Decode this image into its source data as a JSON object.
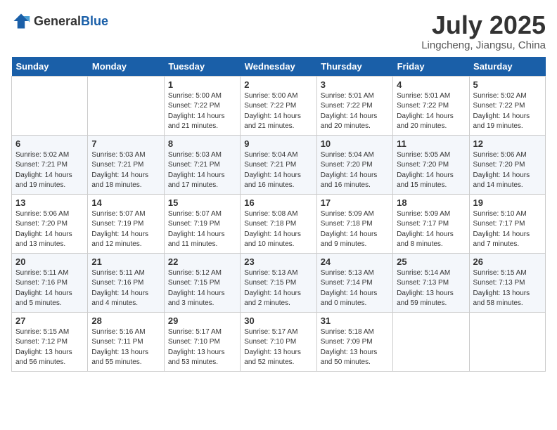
{
  "header": {
    "logo_general": "General",
    "logo_blue": "Blue",
    "month_title": "July 2025",
    "location": "Lingcheng, Jiangsu, China"
  },
  "days_of_week": [
    "Sunday",
    "Monday",
    "Tuesday",
    "Wednesday",
    "Thursday",
    "Friday",
    "Saturday"
  ],
  "weeks": [
    [
      {
        "day": "",
        "info": ""
      },
      {
        "day": "",
        "info": ""
      },
      {
        "day": "1",
        "info": "Sunrise: 5:00 AM\nSunset: 7:22 PM\nDaylight: 14 hours and 21 minutes."
      },
      {
        "day": "2",
        "info": "Sunrise: 5:00 AM\nSunset: 7:22 PM\nDaylight: 14 hours and 21 minutes."
      },
      {
        "day": "3",
        "info": "Sunrise: 5:01 AM\nSunset: 7:22 PM\nDaylight: 14 hours and 20 minutes."
      },
      {
        "day": "4",
        "info": "Sunrise: 5:01 AM\nSunset: 7:22 PM\nDaylight: 14 hours and 20 minutes."
      },
      {
        "day": "5",
        "info": "Sunrise: 5:02 AM\nSunset: 7:22 PM\nDaylight: 14 hours and 19 minutes."
      }
    ],
    [
      {
        "day": "6",
        "info": "Sunrise: 5:02 AM\nSunset: 7:21 PM\nDaylight: 14 hours and 19 minutes."
      },
      {
        "day": "7",
        "info": "Sunrise: 5:03 AM\nSunset: 7:21 PM\nDaylight: 14 hours and 18 minutes."
      },
      {
        "day": "8",
        "info": "Sunrise: 5:03 AM\nSunset: 7:21 PM\nDaylight: 14 hours and 17 minutes."
      },
      {
        "day": "9",
        "info": "Sunrise: 5:04 AM\nSunset: 7:21 PM\nDaylight: 14 hours and 16 minutes."
      },
      {
        "day": "10",
        "info": "Sunrise: 5:04 AM\nSunset: 7:20 PM\nDaylight: 14 hours and 16 minutes."
      },
      {
        "day": "11",
        "info": "Sunrise: 5:05 AM\nSunset: 7:20 PM\nDaylight: 14 hours and 15 minutes."
      },
      {
        "day": "12",
        "info": "Sunrise: 5:06 AM\nSunset: 7:20 PM\nDaylight: 14 hours and 14 minutes."
      }
    ],
    [
      {
        "day": "13",
        "info": "Sunrise: 5:06 AM\nSunset: 7:20 PM\nDaylight: 14 hours and 13 minutes."
      },
      {
        "day": "14",
        "info": "Sunrise: 5:07 AM\nSunset: 7:19 PM\nDaylight: 14 hours and 12 minutes."
      },
      {
        "day": "15",
        "info": "Sunrise: 5:07 AM\nSunset: 7:19 PM\nDaylight: 14 hours and 11 minutes."
      },
      {
        "day": "16",
        "info": "Sunrise: 5:08 AM\nSunset: 7:18 PM\nDaylight: 14 hours and 10 minutes."
      },
      {
        "day": "17",
        "info": "Sunrise: 5:09 AM\nSunset: 7:18 PM\nDaylight: 14 hours and 9 minutes."
      },
      {
        "day": "18",
        "info": "Sunrise: 5:09 AM\nSunset: 7:17 PM\nDaylight: 14 hours and 8 minutes."
      },
      {
        "day": "19",
        "info": "Sunrise: 5:10 AM\nSunset: 7:17 PM\nDaylight: 14 hours and 7 minutes."
      }
    ],
    [
      {
        "day": "20",
        "info": "Sunrise: 5:11 AM\nSunset: 7:16 PM\nDaylight: 14 hours and 5 minutes."
      },
      {
        "day": "21",
        "info": "Sunrise: 5:11 AM\nSunset: 7:16 PM\nDaylight: 14 hours and 4 minutes."
      },
      {
        "day": "22",
        "info": "Sunrise: 5:12 AM\nSunset: 7:15 PM\nDaylight: 14 hours and 3 minutes."
      },
      {
        "day": "23",
        "info": "Sunrise: 5:13 AM\nSunset: 7:15 PM\nDaylight: 14 hours and 2 minutes."
      },
      {
        "day": "24",
        "info": "Sunrise: 5:13 AM\nSunset: 7:14 PM\nDaylight: 14 hours and 0 minutes."
      },
      {
        "day": "25",
        "info": "Sunrise: 5:14 AM\nSunset: 7:13 PM\nDaylight: 13 hours and 59 minutes."
      },
      {
        "day": "26",
        "info": "Sunrise: 5:15 AM\nSunset: 7:13 PM\nDaylight: 13 hours and 58 minutes."
      }
    ],
    [
      {
        "day": "27",
        "info": "Sunrise: 5:15 AM\nSunset: 7:12 PM\nDaylight: 13 hours and 56 minutes."
      },
      {
        "day": "28",
        "info": "Sunrise: 5:16 AM\nSunset: 7:11 PM\nDaylight: 13 hours and 55 minutes."
      },
      {
        "day": "29",
        "info": "Sunrise: 5:17 AM\nSunset: 7:10 PM\nDaylight: 13 hours and 53 minutes."
      },
      {
        "day": "30",
        "info": "Sunrise: 5:17 AM\nSunset: 7:10 PM\nDaylight: 13 hours and 52 minutes."
      },
      {
        "day": "31",
        "info": "Sunrise: 5:18 AM\nSunset: 7:09 PM\nDaylight: 13 hours and 50 minutes."
      },
      {
        "day": "",
        "info": ""
      },
      {
        "day": "",
        "info": ""
      }
    ]
  ]
}
